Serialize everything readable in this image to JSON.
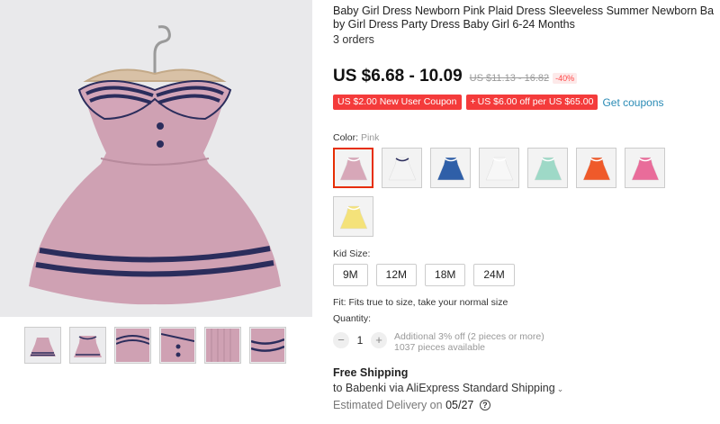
{
  "product": {
    "title": "Baby Girl Dress Newborn Pink Plaid Dress Sleeveless Summer Newborn Baby Girl Dress Party Dress Baby Girl 6-24 Months",
    "orders": "3 orders",
    "price": "US $6.68 - 10.09",
    "old_price": "US $11.13 - 16.82",
    "discount": "-40%"
  },
  "coupons": {
    "new_user": "US $2.00 New User Coupon",
    "off_tag": "+",
    "off": "US $6.00 off per US $65.00",
    "get": "Get coupons"
  },
  "color": {
    "label": "Color:",
    "selected": "Pink",
    "options": [
      {
        "name": "pink",
        "color": "#d7a7b8"
      },
      {
        "name": "white-navy",
        "color": "#f4f4f4"
      },
      {
        "name": "blue",
        "color": "#2f5fa8"
      },
      {
        "name": "white-print",
        "color": "#f7f7f7"
      },
      {
        "name": "mint",
        "color": "#9ed9c7"
      },
      {
        "name": "orange",
        "color": "#ef5a2a"
      },
      {
        "name": "rose",
        "color": "#e96c9a"
      },
      {
        "name": "yellow",
        "color": "#f4e27a"
      }
    ]
  },
  "size": {
    "label": "Kid Size:",
    "options": [
      "9M",
      "12M",
      "18M",
      "24M"
    ]
  },
  "fit": "Fit: Fits true to size, take your normal size",
  "quantity": {
    "label": "Quantity:",
    "minus": "−",
    "value": "1",
    "plus": "+",
    "note1": "Additional 3% off (2 pieces or more)",
    "note2": "1037 pieces available"
  },
  "shipping": {
    "title": "Free Shipping",
    "via": "to Babenki via AliExpress Standard Shipping",
    "delivery_label": "Estimated Delivery on",
    "delivery_date": "05/27",
    "help": "?"
  },
  "icons": [
    "dress-image",
    "chevron-down-icon",
    "help-icon"
  ]
}
